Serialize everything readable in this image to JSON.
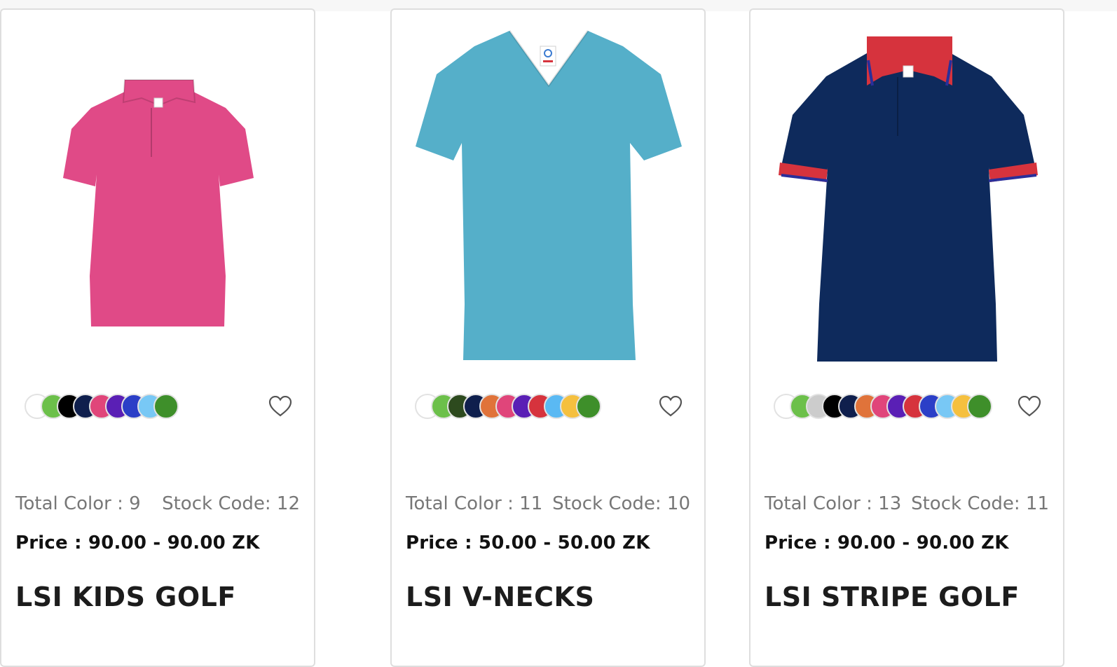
{
  "products": [
    {
      "name": "LSI V-NECKS",
      "total_color_label": "Total Color : 11",
      "stock_code_label": "Stock Code: 10",
      "price_label": "Price : 50.00 - 50.00 ZK",
      "shirt_color": "#55afc9",
      "colors": [
        "#ffffff",
        "#6cc04a",
        "#2d4a1e",
        "#0f1f4d",
        "#e0733a",
        "#e0457a",
        "#5a1fb5",
        "#d6333d",
        "#5ab9f3",
        "#f5c03f",
        "#3e8f2a"
      ]
    },
    {
      "name": "LSI STRIPE GOLF",
      "total_color_label": "Total Color : 13",
      "stock_code_label": "Stock Code: 11",
      "price_label": "Price : 90.00 - 90.00 ZK",
      "shirt_color": "#0e2a5c",
      "accent_color": "#d6333d",
      "colors": [
        "#ffffff",
        "#6cc04a",
        "#cccccc",
        "#000000",
        "#0f1f4d",
        "#e0733a",
        "#e0457a",
        "#5a1fb5",
        "#d6333d",
        "#2b3fc7",
        "#78c8f5",
        "#f5c03f",
        "#3e8f2a"
      ]
    },
    {
      "name": "LSI KIDS GOLF",
      "total_color_label": "Total Color : 9",
      "stock_code_label": "Stock Code: 12",
      "price_label": "Price : 90.00 - 90.00 ZK",
      "shirt_color": "#e04a87",
      "colors": [
        "#ffffff",
        "#6cc04a",
        "#000000",
        "#0f1f4d",
        "#e0457a",
        "#5a1fb5",
        "#2b3fc7",
        "#78c8f5",
        "#3e8f2a"
      ]
    }
  ],
  "icons": {
    "favorite": "heart-outline-icon"
  }
}
